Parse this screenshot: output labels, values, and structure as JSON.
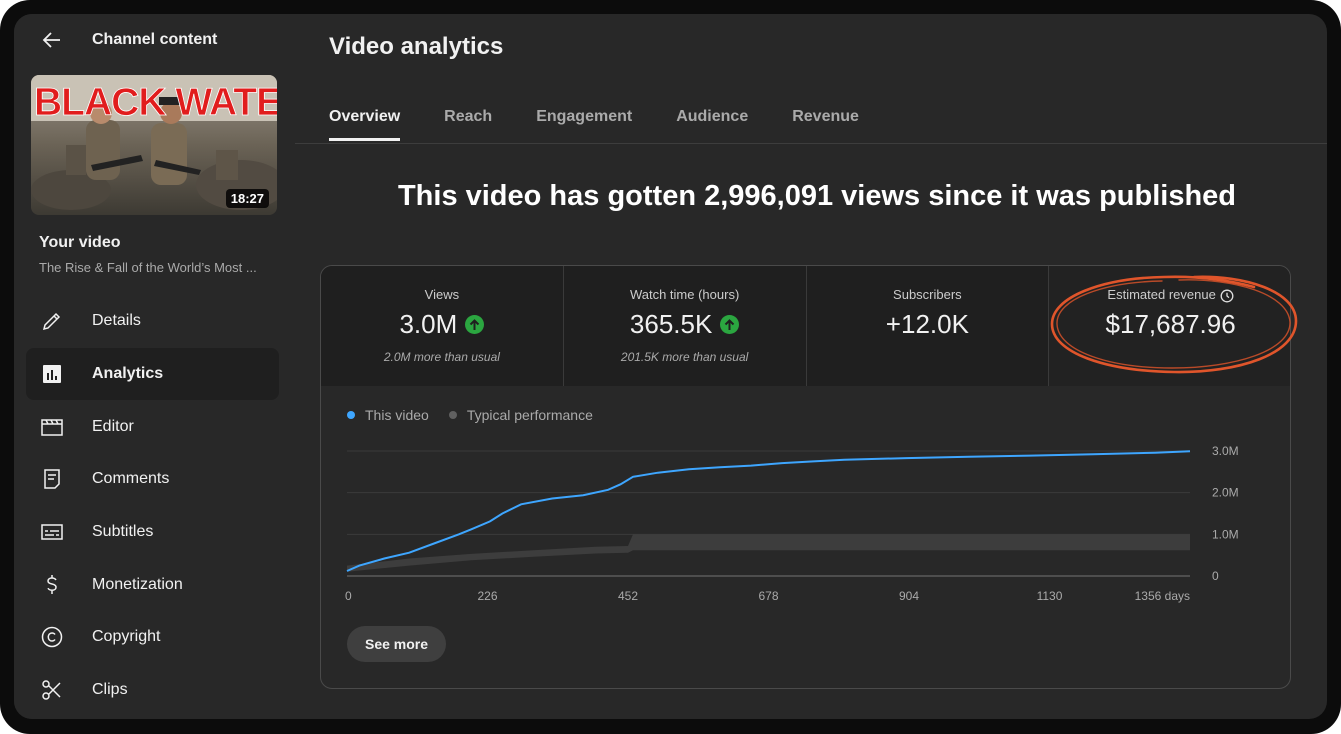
{
  "header": {
    "back_icon": "arrow-left-icon",
    "title": "Channel content"
  },
  "video": {
    "thumbnail_text": "BLACK WATER",
    "duration": "18:27",
    "label": "Your video",
    "title": "The Rise & Fall of the World’s Most ..."
  },
  "sidebar": {
    "items": [
      {
        "label": "Details",
        "icon": "pencil-icon",
        "active": false
      },
      {
        "label": "Analytics",
        "icon": "analytics-icon",
        "active": true
      },
      {
        "label": "Editor",
        "icon": "clapperboard-icon",
        "active": false
      },
      {
        "label": "Comments",
        "icon": "comment-icon",
        "active": false
      },
      {
        "label": "Subtitles",
        "icon": "subtitles-icon",
        "active": false
      },
      {
        "label": "Monetization",
        "icon": "dollar-icon",
        "active": false
      },
      {
        "label": "Copyright",
        "icon": "copyright-icon",
        "active": false
      },
      {
        "label": "Clips",
        "icon": "scissors-icon",
        "active": false
      }
    ]
  },
  "page": {
    "title": "Video analytics",
    "tabs": [
      "Overview",
      "Reach",
      "Engagement",
      "Audience",
      "Revenue"
    ],
    "active_tab": "Overview",
    "headline": "This video has gotten 2,996,091 views since it was published"
  },
  "metrics": [
    {
      "label": "Views",
      "value": "3.0M",
      "trend": "up",
      "sub": "2.0M more than usual"
    },
    {
      "label": "Watch time (hours)",
      "value": "365.5K",
      "trend": "up",
      "sub": "201.5K more than usual"
    },
    {
      "label": "Subscribers",
      "value": "+12.0K",
      "trend": "",
      "sub": ""
    },
    {
      "label": "Estimated revenue",
      "value": "$17,687.96",
      "trend": "",
      "sub": "",
      "icon": "clock-icon"
    }
  ],
  "legend": {
    "this_video": "This video",
    "typical": "Typical performance"
  },
  "see_more": "See more",
  "colors": {
    "accent": "#3ea6ff",
    "typical": "#606060",
    "up": "#2ba640",
    "annotation": "#e0552b"
  },
  "chart_data": {
    "type": "line",
    "x_unit": "days",
    "x_ticks": [
      "0",
      "226",
      "452",
      "678",
      "904",
      "1130",
      "1356 days"
    ],
    "y_ticks": [
      "0",
      "1.0M",
      "2.0M",
      "3.0M"
    ],
    "xlim": [
      0,
      1356
    ],
    "ylim": [
      0,
      3000000
    ],
    "series": [
      {
        "name": "This video",
        "x": [
          0,
          20,
          60,
          100,
          140,
          180,
          200,
          230,
          250,
          280,
          330,
          380,
          420,
          440,
          460,
          500,
          550,
          600,
          650,
          700,
          750,
          800,
          900,
          1000,
          1100,
          1200,
          1300,
          1356
        ],
        "y": [
          120000,
          250000,
          420000,
          560000,
          780000,
          1000000,
          1120000,
          1310000,
          1500000,
          1720000,
          1860000,
          1940000,
          2070000,
          2200000,
          2380000,
          2480000,
          2560000,
          2610000,
          2650000,
          2710000,
          2750000,
          2790000,
          2830000,
          2860000,
          2890000,
          2920000,
          2960000,
          2996091
        ]
      },
      {
        "name": "Typical performance",
        "x": [
          0,
          100,
          200,
          300,
          400,
          452,
          460,
          600,
          800,
          1000,
          1200,
          1356
        ],
        "y_low": [
          100000,
          250000,
          380000,
          460000,
          540000,
          560000,
          620000,
          620000,
          620000,
          620000,
          620000,
          620000
        ],
        "y_high": [
          250000,
          420000,
          530000,
          620000,
          700000,
          720000,
          1000000,
          1000000,
          1000000,
          1000000,
          1000000,
          1000000
        ]
      }
    ],
    "grid": true,
    "legend_position": "top-left"
  }
}
